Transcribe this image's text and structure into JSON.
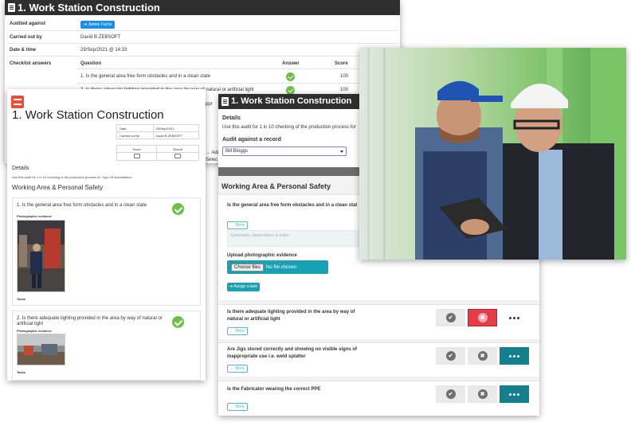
{
  "back_report": {
    "title": "1. Work Station Construction",
    "audited_against_label": "Audited against",
    "audited_against_value": "➔ James Fuchs",
    "carried_out_by_label": "Carried out by",
    "carried_out_by_value": "David B ZEBSOFT",
    "date_time_label": "Date & time",
    "date_time_value": "29/Sep/2021 @ 14:33",
    "checklist_label": "Checklist answers",
    "col_question": "Question",
    "col_answer": "Answer",
    "col_score": "Score",
    "rows": [
      {
        "question": "1. Is the general area free form obstacles and in a clean state",
        "score": "100"
      },
      {
        "question": "2. Is there adequate lighting provided in the area by way of natural or artificial light",
        "score": "100"
      }
    ],
    "partial_1": "ppr",
    "partial_2": "→ Add a",
    "partial_3": "Selec"
  },
  "print_form": {
    "title": "1. Work Station Construction",
    "date_label": "Date",
    "date_value": "29/Sep/2021",
    "carried_label": "Carried out by",
    "carried_value": "David B ZEBSOFT",
    "score_label": "Score",
    "result_label": "Result",
    "details_heading": "Details",
    "details_text": "Use this audit for 1 in 10 checking of the production process for Type 28 workstations",
    "section_heading": "Working Area & Personal Safety",
    "q1": "1. Is the general area free form obstacles and in a clean state",
    "q2": "2. Is there adequate lighting provided in the area by way of natural or artificial light",
    "photo_label": "Photographic evidence",
    "tasks_label": "Tasks"
  },
  "mobile_app": {
    "title": "1. Work Station Construction",
    "details_label": "Details",
    "details_text": "Use this audit for 1 in 10 checking of the production process for",
    "audit_against_label": "Audit against a record",
    "audit_against_value": "Bill Bloggs",
    "section_heading": "Working Area & Personal Safety",
    "q1": "Is the general area free form obstacles and in a clean stat",
    "more_label": "← More",
    "comments_placeholder": "Comments, observations & notes",
    "upload_label": "Upload photographic evidence",
    "choose_files_label": "Choose files",
    "no_file_label": "No file chosen",
    "assign_task_label": "➔ Assign a task",
    "q2": "Is there adequate lighting provided in the area by way of natural or artificial light",
    "q3": "Are Jigs stored correctly and showing no visible signs of inappropriate use i.e. weld splatter",
    "q4": "Is the Fabricator wearing the correct PPE",
    "check_glyph": "✔",
    "cross_glyph": "✖"
  },
  "colors": {
    "titlebar": "#2f2f2f",
    "accent_teal": "#1aa0b3",
    "accent_red": "#e33d4a",
    "tick_green": "#6cc04a",
    "button_blue": "#1f8fe6"
  }
}
